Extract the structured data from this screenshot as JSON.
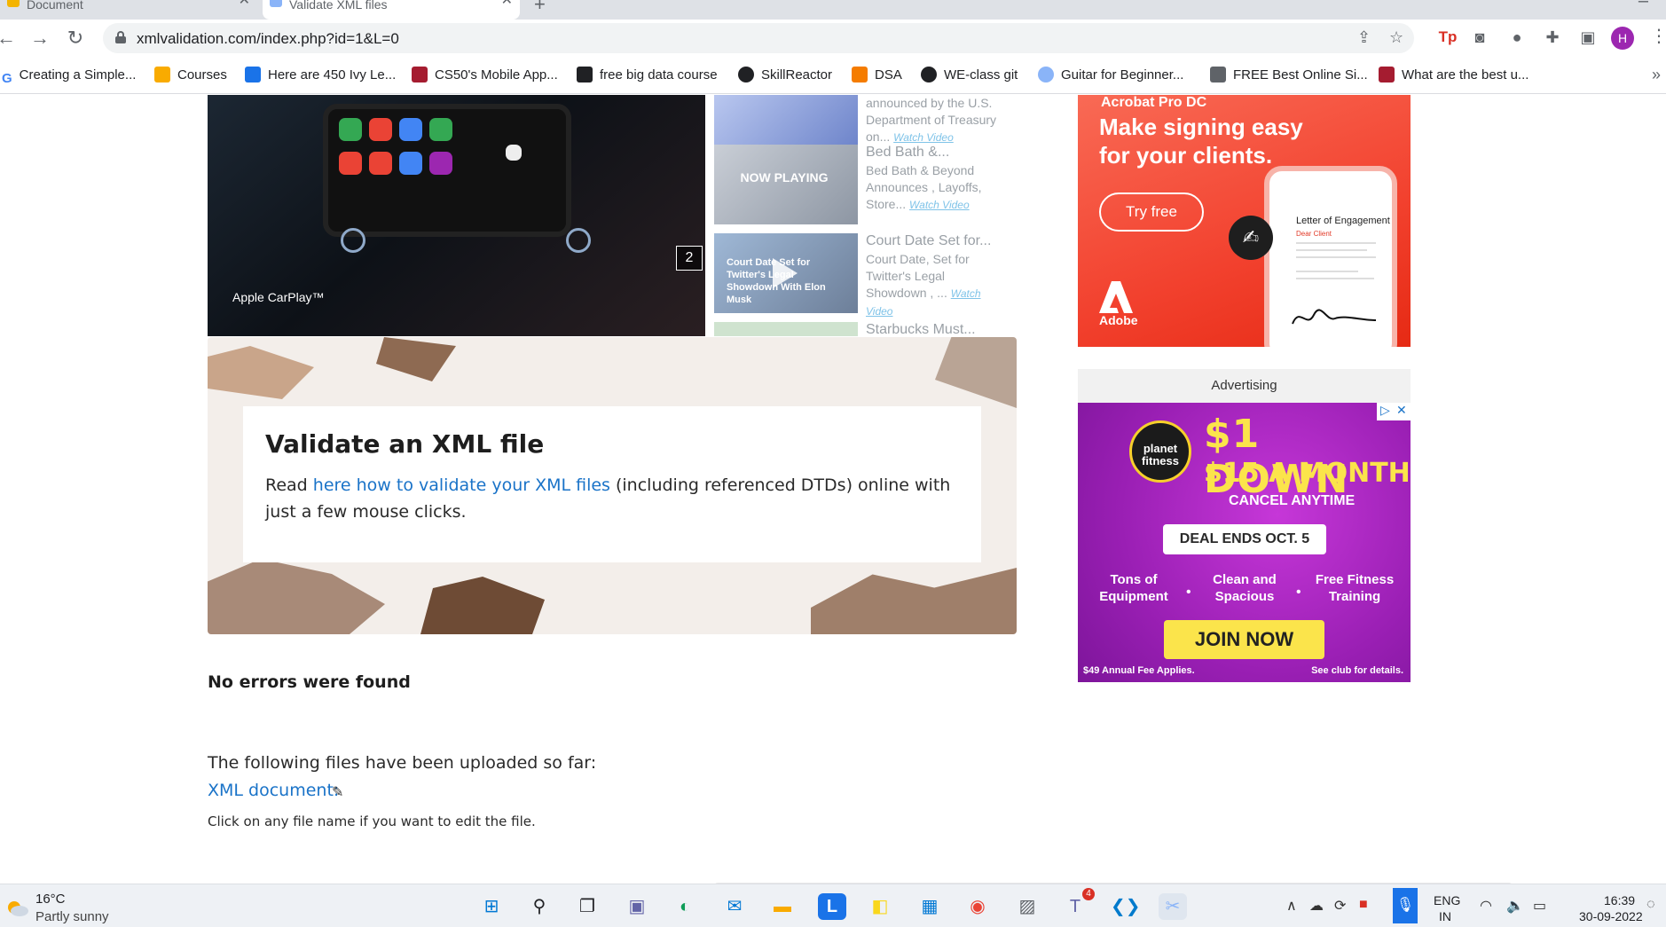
{
  "browser": {
    "tabs": [
      {
        "label": "Document",
        "active": false
      },
      {
        "label": "Validate XML files",
        "active": true
      }
    ],
    "url": "xmlvalidation.com/index.php?id=1&L=0",
    "profile_initial": "H",
    "bookmarks": [
      "Creating a Simple...",
      "Courses",
      "Here are 450 Ivy Le...",
      "CS50's Mobile App...",
      "free big data course",
      "SkillReactor",
      "DSA",
      "WE-class git",
      "Guitar for Beginner...",
      "FREE Best Online Si...",
      "What are the best u..."
    ]
  },
  "videos": {
    "main_label": "Apple CarPlay™",
    "counter": "2",
    "side": [
      {
        "title": "",
        "desc": "announced by the U.S. Department of Treasury on...",
        "watch": "Watch Video"
      },
      {
        "title": "Bed Bath &...",
        "thumb": "NOW PLAYING",
        "desc": "Bed Bath & Beyond Announces , Layoffs, Store...",
        "watch": "Watch Video"
      },
      {
        "title": "Court Date Set for...",
        "thumb": "Court Date Set for Twitter's Legal Showdown With Elon Musk",
        "desc": "Court Date, Set for Twitter's Legal Showdown , ...",
        "watch": "Watch Video"
      },
      {
        "title": "Starbucks Must...",
        "desc": "",
        "watch": ""
      }
    ]
  },
  "hero": {
    "title": "Validate an XML file",
    "text_before": "Read ",
    "link": "here how to validate your XML files",
    "text_after": " (including referenced DTDs) online with just a few mouse clicks."
  },
  "result": {
    "status": "No errors were found",
    "uploaded_intro": "The following files have been uploaded so far:",
    "file_link": "XML document:",
    "hint": "Click on any file name if you want to edit the file."
  },
  "ads": {
    "adobe": {
      "brand": "Acrobat Pro DC",
      "headline": "Make signing easy for your clients.",
      "cta": "Try free",
      "logo_text": "Adobe",
      "doc_title": "Letter of Engagement",
      "doc_greeting": "Dear Client"
    },
    "label": "Advertising",
    "planet_fitness": {
      "logo": "planet fitness",
      "line1": "$1 DOWN",
      "line2": "$15 A MONTH",
      "line3": "CANCEL ANYTIME",
      "deal": "DEAL ENDS OCT. 5",
      "features": [
        "Tons of Equipment",
        "Clean and Spacious",
        "Free Fitness Training"
      ],
      "cta": "JOIN NOW",
      "fine_left": "$49 Annual Fee Applies.",
      "fine_right": "See club for details."
    }
  },
  "taskbar": {
    "temp": "16°C",
    "weather": "Partly sunny",
    "lang1": "ENG",
    "lang2": "IN",
    "time": "16:39",
    "date": "30-09-2022",
    "teams_badge": "4"
  }
}
